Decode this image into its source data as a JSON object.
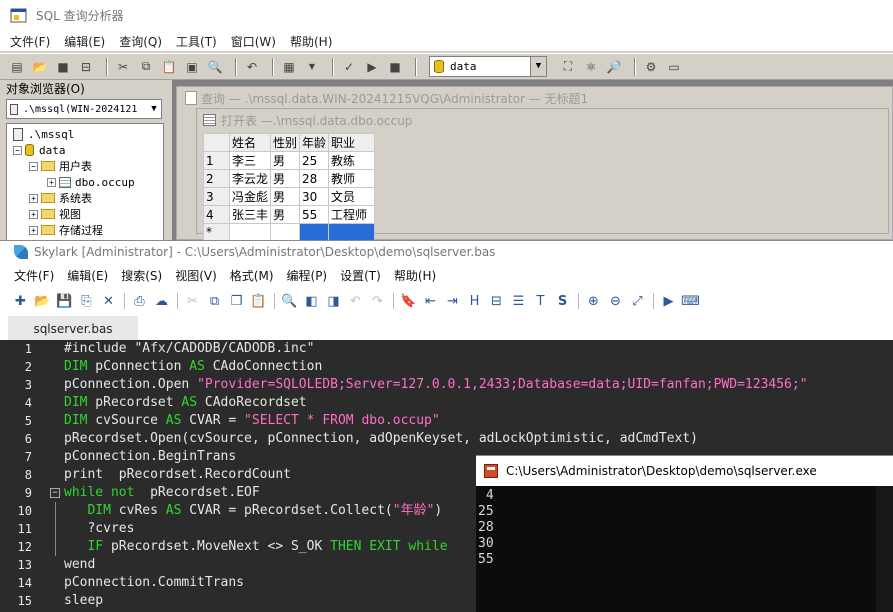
{
  "query_analyzer": {
    "title": "SQL 查询分析器",
    "menu": [
      "文件(F)",
      "编辑(E)",
      "查询(Q)",
      "工具(T)",
      "窗口(W)",
      "帮助(H)"
    ],
    "database_select": "data",
    "object_browser": {
      "header": "对象浏览器(O)",
      "server_combo": ".\\mssql(WIN-2024121",
      "tree": [
        {
          "label": ".\\mssql",
          "icon": "server-icon"
        },
        {
          "label": "data",
          "icon": "database-icon"
        },
        {
          "label": "用户表",
          "icon": "folder-icon"
        },
        {
          "label": "dbo.occup",
          "icon": "table-icon"
        },
        {
          "label": "系统表",
          "icon": "folder-icon"
        },
        {
          "label": "视图",
          "icon": "folder-icon"
        },
        {
          "label": "存储过程",
          "icon": "folder-icon"
        }
      ]
    },
    "query_window_title": "查询 — .\\mssql.data.WIN-20241215VQG\\Administrator — 无标题1",
    "open_table_title": "打开表 —.\\mssql.data.dbo.occup",
    "grid": {
      "columns": [
        "姓名",
        "性别",
        "年龄",
        "职业"
      ],
      "rows": [
        [
          "1",
          "李三",
          "男",
          "25",
          "教练"
        ],
        [
          "2",
          "李云龙",
          "男",
          "28",
          "教师"
        ],
        [
          "3",
          "冯金彪",
          "男",
          "30",
          "文员"
        ],
        [
          "4",
          "张三丰",
          "男",
          "55",
          "工程师"
        ]
      ],
      "new_row_marker": "*"
    }
  },
  "skylark": {
    "title": "Skylark [Administrator] - C:\\Users\\Administrator\\Desktop\\demo\\sqlserver.bas",
    "menu": [
      "文件(F)",
      "编辑(E)",
      "搜索(S)",
      "视图(V)",
      "格式(M)",
      "编程(P)",
      "设置(T)",
      "帮助(H)"
    ],
    "tab": "sqlserver.bas",
    "code_lines": [
      {
        "n": "1",
        "parts": [
          [
            "code",
            "#include \"Afx/CADODB/CADODB.inc\""
          ]
        ]
      },
      {
        "n": "2",
        "parts": [
          [
            "kw",
            "DIM"
          ],
          [
            "code",
            " pConnection "
          ],
          [
            "kw",
            "AS"
          ],
          [
            "code",
            " CAdoConnection"
          ]
        ]
      },
      {
        "n": "3",
        "parts": [
          [
            "code",
            "pConnection.Open "
          ],
          [
            "st",
            "\"Provider=SQLOLEDB;Server=127.0.0.1,2433;Database=data;UID=fanfan;PWD=123456;\""
          ]
        ]
      },
      {
        "n": "4",
        "parts": [
          [
            "kw",
            "DIM"
          ],
          [
            "code",
            " pRecordset "
          ],
          [
            "kw",
            "AS"
          ],
          [
            "code",
            " CAdoRecordset"
          ]
        ]
      },
      {
        "n": "5",
        "parts": [
          [
            "kw",
            "DIM"
          ],
          [
            "code",
            " cvSource "
          ],
          [
            "kw",
            "AS"
          ],
          [
            "code",
            " CVAR = "
          ],
          [
            "st",
            "\"SELECT * FROM dbo.occup\""
          ]
        ]
      },
      {
        "n": "6",
        "parts": [
          [
            "code",
            "pRecordset.Open(cvSource, pConnection, adOpenKeyset, adLockOptimistic, adCmdText)"
          ]
        ]
      },
      {
        "n": "7",
        "parts": [
          [
            "code",
            "pConnection.BeginTrans"
          ]
        ]
      },
      {
        "n": "8",
        "parts": [
          [
            "code",
            "print  pRecordset.RecordCount"
          ]
        ]
      },
      {
        "n": "9",
        "parts": [
          [
            "kw",
            "while"
          ],
          [
            "code",
            " "
          ],
          [
            "kw",
            "not"
          ],
          [
            "code",
            "  pRecordset.EOF"
          ]
        ]
      },
      {
        "n": "10",
        "parts": [
          [
            "code",
            "   "
          ],
          [
            "kw",
            "DIM"
          ],
          [
            "code",
            " cvRes "
          ],
          [
            "kw",
            "AS"
          ],
          [
            "code",
            " CVAR = pRecordset.Collect("
          ],
          [
            "st",
            "\"年龄\""
          ],
          [
            "code",
            ")"
          ]
        ]
      },
      {
        "n": "11",
        "parts": [
          [
            "code",
            "   ?cvres"
          ]
        ]
      },
      {
        "n": "12",
        "parts": [
          [
            "code",
            "   "
          ],
          [
            "kw",
            "IF"
          ],
          [
            "code",
            " pRecordset.MoveNext <> S_OK "
          ],
          [
            "kw",
            "THEN"
          ],
          [
            "code",
            " "
          ],
          [
            "kw",
            "EXIT"
          ],
          [
            "code",
            " "
          ],
          [
            "kw",
            "while"
          ]
        ]
      },
      {
        "n": "13",
        "parts": [
          [
            "code",
            "wend"
          ]
        ]
      },
      {
        "n": "14",
        "parts": [
          [
            "code",
            "pConnection.CommitTrans"
          ]
        ]
      },
      {
        "n": "15",
        "parts": [
          [
            "code",
            "sleep"
          ]
        ]
      }
    ],
    "fold_line": "9"
  },
  "console": {
    "title": "C:\\Users\\Administrator\\Desktop\\demo\\sqlserver.exe",
    "output": [
      " 4",
      "25",
      "28",
      "30",
      "55"
    ]
  }
}
